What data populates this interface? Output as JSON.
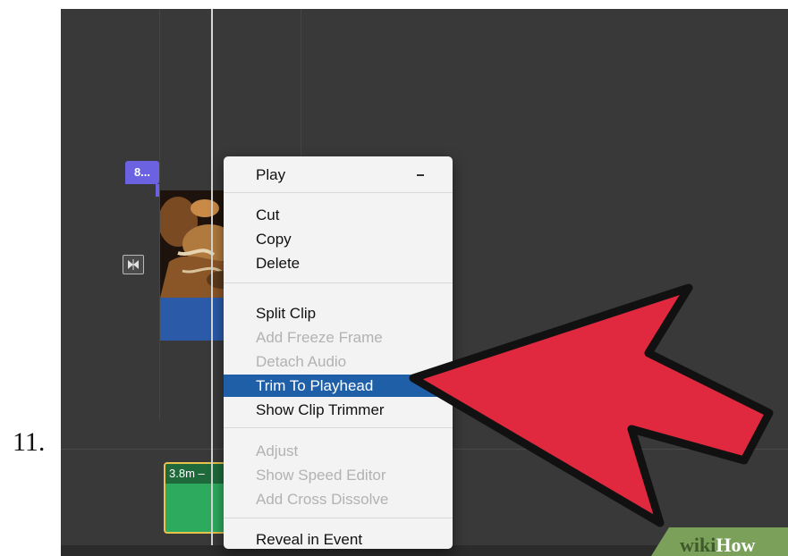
{
  "step": {
    "number": "11."
  },
  "timeline": {
    "clip_title_tag": "8...",
    "audio_clip_label": "3.8m – "
  },
  "context_menu": {
    "items": [
      {
        "label": "Play",
        "enabled": true
      },
      {
        "label": "Cut",
        "enabled": true
      },
      {
        "label": "Copy",
        "enabled": true
      },
      {
        "label": "Delete",
        "enabled": true
      },
      {
        "label": "Split Clip",
        "enabled": true
      },
      {
        "label": "Add Freeze Frame",
        "enabled": false
      },
      {
        "label": "Detach Audio",
        "enabled": false
      },
      {
        "label": "Trim To Playhead",
        "enabled": true,
        "highlighted": true
      },
      {
        "label": "Show Clip Trimmer",
        "enabled": true
      },
      {
        "label": "Adjust",
        "enabled": false
      },
      {
        "label": "Show Speed Editor",
        "enabled": false
      },
      {
        "label": "Add Cross Dissolve",
        "enabled": false
      },
      {
        "label": "Reveal in Event",
        "enabled": true
      }
    ]
  },
  "watermark": {
    "prefix": "wiki",
    "suffix": "How"
  },
  "colors": {
    "highlight": "#1f5fa8",
    "arrow_fill": "#e0283f",
    "title_tag": "#6a62e0",
    "audio_clip": "#2eaa5e",
    "watermark_bg": "#7aa05a"
  },
  "icons": {
    "transition": "transition-bowtie-icon",
    "pointer": "red-arrow-icon"
  }
}
